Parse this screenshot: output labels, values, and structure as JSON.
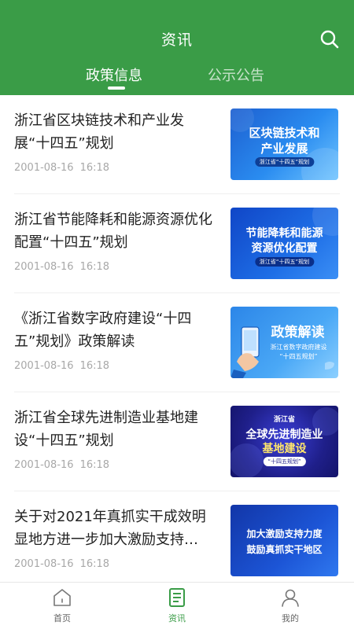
{
  "header": {
    "title": "资讯",
    "search_icon": "search-icon"
  },
  "tabs": [
    {
      "label": "政策信息",
      "active": true
    },
    {
      "label": "公示公告",
      "active": false
    }
  ],
  "news": [
    {
      "title": "浙江省区块链技术和产业发展“十四五”规划",
      "date": "2001-08-16",
      "time": "16:18",
      "thumb": {
        "line1": "区块链技术和",
        "line2": "产业发展",
        "sub": "浙江省“十四五”规划"
      }
    },
    {
      "title": "浙江省节能降耗和能源资源优化配置“十四五”规划",
      "date": "2001-08-16",
      "time": "16:18",
      "thumb": {
        "line1": "节能降耗和能源",
        "line2": "资源优化配置",
        "sub": "浙江省“十四五”规划"
      }
    },
    {
      "title": "《浙江省数字政府建设“十四五”规划》政策解读",
      "date": "2001-08-16",
      "time": "16:18",
      "thumb": {
        "line1": "政策解读",
        "line2": "浙江省数字政府建设",
        "line3": "“十四五规划”"
      }
    },
    {
      "title": "浙江省全球先进制造业基地建设“十四五”规划",
      "date": "2001-08-16",
      "time": "16:18",
      "thumb": {
        "top": "浙江省",
        "line1": "全球先进制造业",
        "line2": "基地建设",
        "sub": "“十四五规划”"
      }
    },
    {
      "title": "关于对2021年真抓实干成效明显地方进一步加大激励支持…",
      "date": "2001-08-16",
      "time": "16:18",
      "thumb": {
        "line1": "加大激励支持力度",
        "line2": "鼓励真抓实干地区"
      }
    }
  ],
  "tabbar": [
    {
      "label": "首页",
      "icon": "home-icon",
      "active": false
    },
    {
      "label": "资讯",
      "icon": "news-icon",
      "active": true
    },
    {
      "label": "我的",
      "icon": "user-icon",
      "active": false
    }
  ],
  "colors": {
    "primary": "#3a9c47"
  }
}
